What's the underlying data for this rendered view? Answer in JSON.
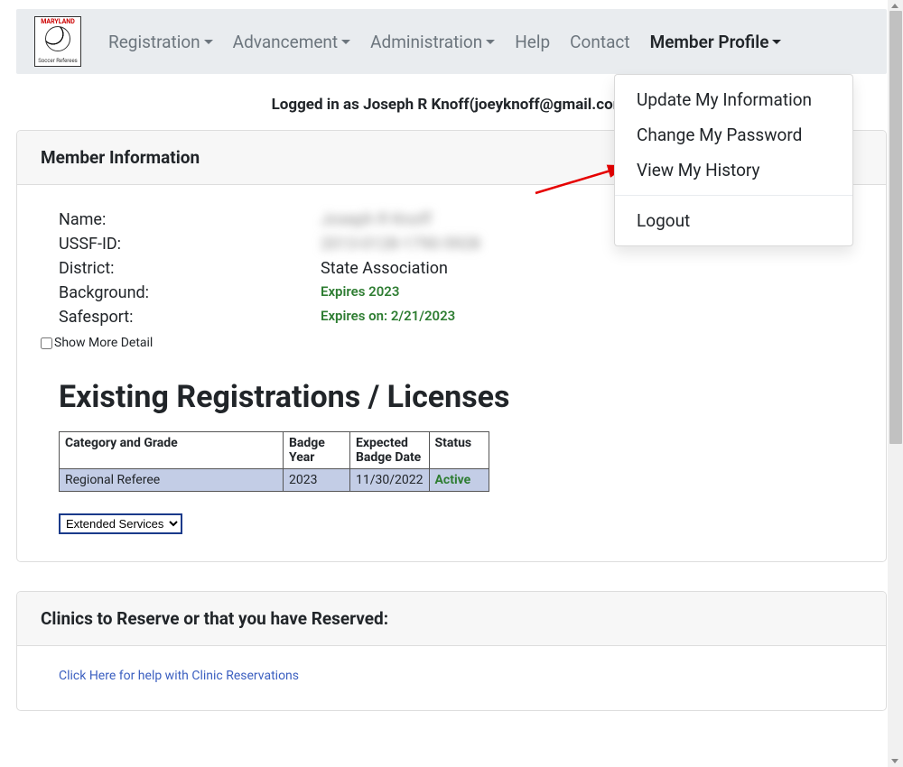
{
  "nav": {
    "items": [
      {
        "label": "Registration",
        "has_caret": true
      },
      {
        "label": "Advancement",
        "has_caret": true
      },
      {
        "label": "Administration",
        "has_caret": true
      },
      {
        "label": "Help",
        "has_caret": false
      },
      {
        "label": "Contact",
        "has_caret": false
      },
      {
        "label": "Member Profile",
        "has_caret": true,
        "active": true
      }
    ]
  },
  "dropdown": {
    "items": [
      {
        "label": "Update My Information"
      },
      {
        "label": "Change My Password"
      },
      {
        "label": "View My History"
      }
    ],
    "logout": "Logout"
  },
  "logged_in_text": "Logged in as Joseph R Knoff(joeyknoff@gmail.com)",
  "member_info": {
    "header": "Member Information",
    "rows": {
      "name_label": "Name:",
      "name_value": "Joseph R Knoff",
      "ussf_label": "USSF-ID:",
      "ussf_value": "2013-0128-1790-5928",
      "district_label": "District:",
      "district_value": "State Association",
      "background_label": "Background:",
      "background_value": "Expires 2023",
      "safesport_label": "Safesport:",
      "safesport_value": "Expires on: 2/21/2023"
    },
    "show_more": "Show More Detail"
  },
  "registrations": {
    "title": "Existing Registrations / Licenses",
    "columns": {
      "cat": "Category and Grade",
      "badge_year": "Badge Year",
      "exp_badge": "Expected Badge Date",
      "status": "Status"
    },
    "rows": [
      {
        "cat": "Regional Referee",
        "badge_year": "2023",
        "exp_badge": "11/30/2022",
        "status": "Active"
      }
    ],
    "ext_select": "Extended Services"
  },
  "clinics": {
    "header": "Clinics to Reserve or that you have Reserved:",
    "help_link": "Click Here for help with Clinic Reservations"
  },
  "logo": {
    "top": "MARYLAND",
    "bottom": "Soccer Referees"
  }
}
